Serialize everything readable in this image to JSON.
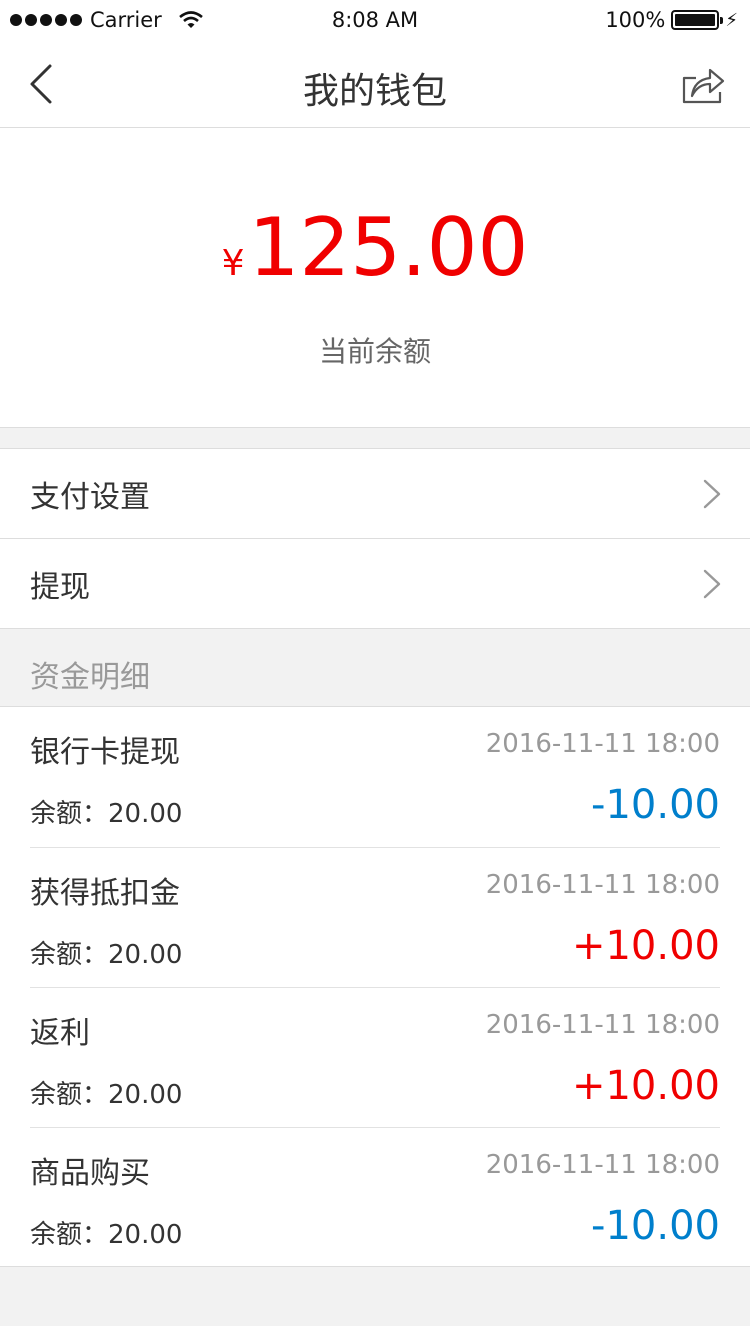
{
  "status_bar": {
    "carrier": "Carrier",
    "time": "8:08 AM",
    "battery": "100%",
    "battery_level": 1.0
  },
  "nav": {
    "title": "我的钱包",
    "back_icon": "chevron-left-icon",
    "share_icon": "share-icon"
  },
  "wallet": {
    "currency": "¥",
    "amount": "125.00",
    "label": "当前余额",
    "accent_color": "#F00000"
  },
  "menu": [
    {
      "label": "支付设置"
    },
    {
      "label": "提现"
    }
  ],
  "details": {
    "title": "资金明细",
    "records": [
      {
        "title": "银行卡提现",
        "time": "2016-11-11  18:00",
        "balance": "余额：20.00",
        "amount": "-10.00",
        "type": "neg"
      },
      {
        "title": "获得抵扣金",
        "time": "2016-11-11  18:00",
        "balance": "余额：20.00",
        "amount": "+10.00",
        "type": "pos"
      },
      {
        "title": "返利",
        "time": "2016-11-11  18:00",
        "balance": "余额：20.00",
        "amount": "+10.00",
        "type": "pos"
      },
      {
        "title": "商品购买",
        "time": "2016-11-11  18:00",
        "balance": "余额：20.00",
        "amount": "-10.00",
        "type": "neg"
      }
    ]
  },
  "colors": {
    "negative": "#007FCC",
    "positive": "#F00000",
    "primary_text": "#333333",
    "secondary_text": "#999999"
  }
}
